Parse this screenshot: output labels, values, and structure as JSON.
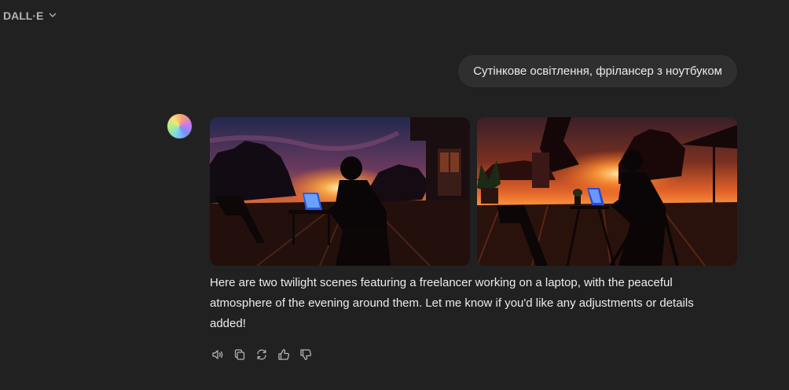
{
  "header": {
    "model_name": "DALL·E",
    "chevron_icon": "chevron-down-icon"
  },
  "user_message": {
    "text": "Сутінкове освітлення, фрілансер з ноутбуком"
  },
  "assistant": {
    "avatar_icon": "dalle-avatar-icon",
    "images": [
      {
        "subject": "silhouette of freelancer with laptop on wooden deck at sunset"
      },
      {
        "subject": "silhouette of freelancer at laptop table on terrace at sunset"
      }
    ],
    "response_text": "Here are two twilight scenes featuring a freelancer working on a laptop, with the peaceful atmosphere of the evening around them. Let me know if you'd like any adjustments or details added!",
    "actions": [
      {
        "icon": "speaker-icon",
        "name": "read-aloud-button"
      },
      {
        "icon": "copy-icon",
        "name": "copy-button"
      },
      {
        "icon": "regenerate-icon",
        "name": "regenerate-button"
      },
      {
        "icon": "thumbs-up-icon",
        "name": "good-response-button"
      },
      {
        "icon": "thumbs-down-icon",
        "name": "bad-response-button"
      }
    ]
  },
  "colors": {
    "background": "#212121",
    "bubble": "#2f2f2f",
    "text": "#ececec",
    "muted": "#b4b4b4"
  }
}
